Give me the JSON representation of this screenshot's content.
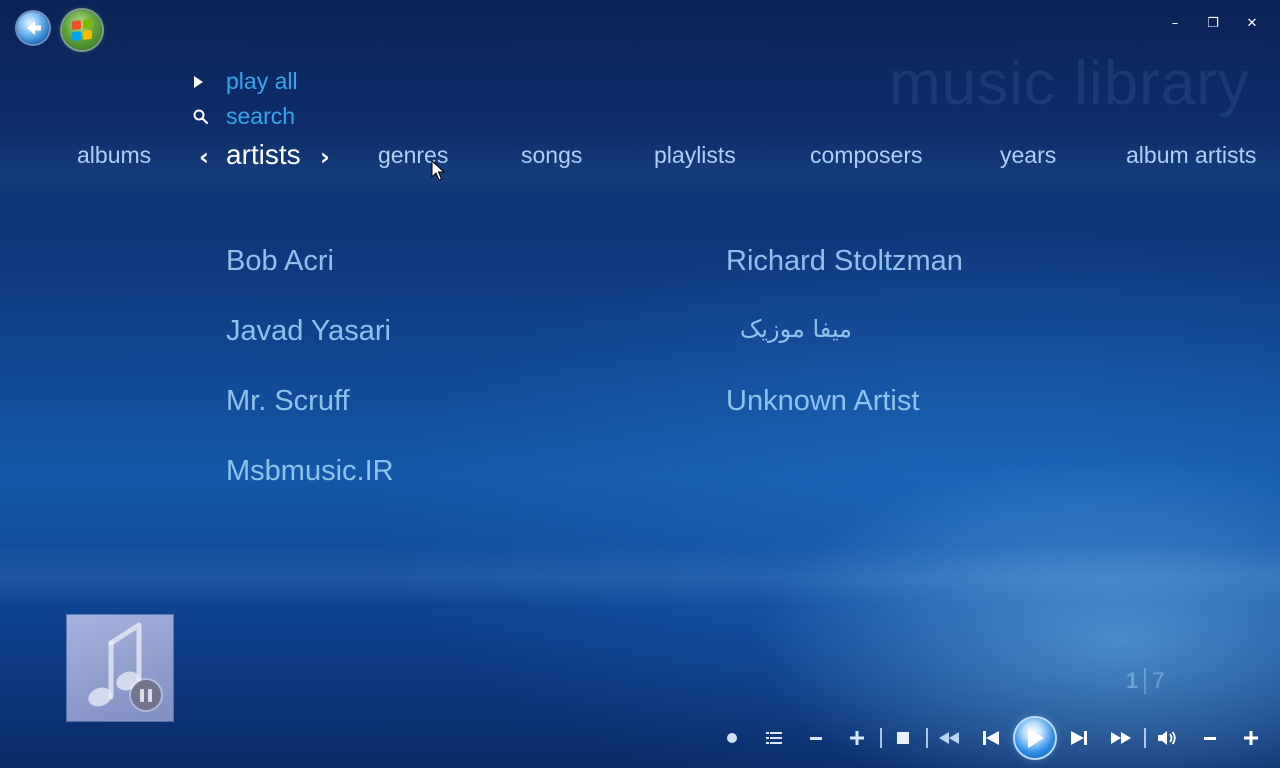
{
  "window": {
    "title_watermark": "music library",
    "controls": {
      "minimize": "–",
      "restore": "❐",
      "close": "✕"
    }
  },
  "quick_actions": {
    "play_all": "play all",
    "search": "search"
  },
  "categories": {
    "albums": "albums",
    "artists": "artists",
    "genres": "genres",
    "songs": "songs",
    "playlists": "playlists",
    "composers": "composers",
    "years": "years",
    "album_artists": "album artists",
    "active": "artists"
  },
  "artists": [
    "Bob Acri",
    "Javad Yasari",
    "Mr. Scruff",
    "Msbmusic.IR",
    "Richard Stoltzman",
    "میفا موزیک",
    "Unknown Artist"
  ],
  "pager": {
    "current": "1",
    "total": "7"
  },
  "now_playing": {
    "state": "paused",
    "art_icon": "music-note-icon"
  },
  "transport": {
    "icons": [
      "record-dot-icon",
      "list-icon",
      "minus-icon",
      "plus-icon",
      "stop-icon",
      "rewind-icon",
      "previous-icon",
      "play-icon",
      "next-icon",
      "fast-forward-icon",
      "volume-icon",
      "volume-down-icon",
      "volume-up-icon"
    ]
  },
  "colors": {
    "accent_link": "#37a6ea",
    "item_text": "#8ec2ea",
    "active_category": "#ffffff",
    "background_dark": "#0b2356",
    "background_mid": "#1457a8"
  }
}
